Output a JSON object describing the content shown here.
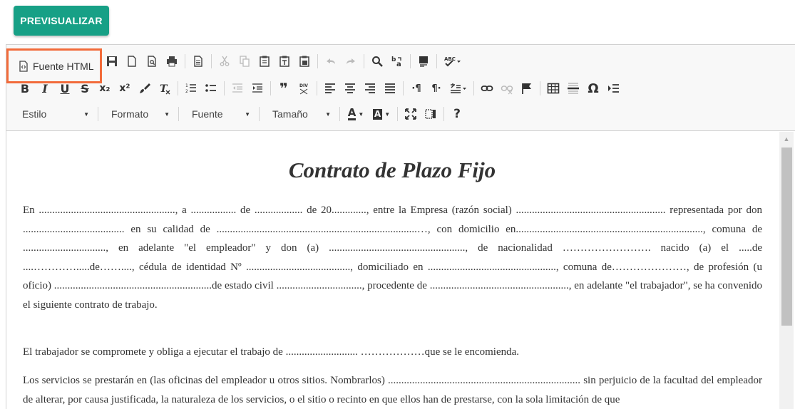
{
  "preview_button": "PREVISUALIZAR",
  "toolbar": {
    "source_label": "Fuente HTML",
    "combos": {
      "style": "Estilo",
      "format": "Formato",
      "font": "Fuente",
      "size": "Tamaño"
    },
    "glyphs": {
      "bold": "B",
      "italic": "I",
      "underline": "U",
      "strike": "S",
      "subscript": "x₂",
      "superscript": "x²",
      "quote": "❞",
      "pilcrow_ltr": "·¶",
      "pilcrow_rtl": "¶·",
      "omega": "Ω",
      "help": "?",
      "text_color": "A",
      "bg_color": "A"
    }
  },
  "document": {
    "title": "Contrato de Plazo Fijo",
    "paragraph1": "En ..................................................., a ................. de .................. de 20............., entre la Empresa (razón social) ........................................................ representada por don ...................................... en su calidad de ...........................................................................…, con domicilio en......................................................................, comuna de ..............................., en adelante \"el empleador\" y don (a) ..................................................., de nacionalidad ……………………. nacido (a) el .....de ....………….....de……...., cédula de identidad Nº ......................................., domiciliado en ................................................, comuna de…………………, de profesión (u oficio) ...........................................................de estado civil ................................, procedente de ...................................................., en adelante \"el trabajador\", se ha convenido el siguiente contrato de trabajo.",
    "paragraph2": "El trabajador se compromete y obliga a ejecutar el trabajo de ........................... ………………que se le encomienda.",
    "paragraph3": "Los servicios se prestarán en (las oficinas del empleador u otros sitios. Nombrarlos) ........................................................................ sin perjuicio de la facultad del empleador de alterar, por causa justificada, la naturaleza de los servicios, o el sitio o recinto en que ellos han de prestarse, con la sola limitación de que"
  },
  "colors": {
    "preview_bg": "#17a086",
    "highlight": "#f26b3a"
  }
}
